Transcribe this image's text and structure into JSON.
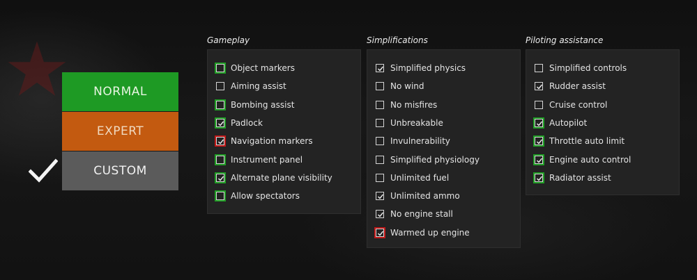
{
  "modes": {
    "normal": "NORMAL",
    "expert": "EXPERT",
    "custom": "CUSTOM",
    "selected": "custom"
  },
  "panels": [
    {
      "title": "Gameplay",
      "options": [
        {
          "label": "Object markers",
          "checked": false,
          "highlight": "green"
        },
        {
          "label": "Aiming assist",
          "checked": false,
          "highlight": "none"
        },
        {
          "label": "Bombing assist",
          "checked": false,
          "highlight": "green"
        },
        {
          "label": "Padlock",
          "checked": true,
          "highlight": "green"
        },
        {
          "label": "Navigation markers",
          "checked": true,
          "highlight": "red"
        },
        {
          "label": "Instrument panel",
          "checked": false,
          "highlight": "green"
        },
        {
          "label": "Alternate plane visibility",
          "checked": true,
          "highlight": "green"
        },
        {
          "label": "Allow spectators",
          "checked": false,
          "highlight": "green"
        }
      ]
    },
    {
      "title": "Simplifications",
      "options": [
        {
          "label": "Simplified physics",
          "checked": true,
          "highlight": "none"
        },
        {
          "label": "No wind",
          "checked": false,
          "highlight": "none"
        },
        {
          "label": "No misfires",
          "checked": false,
          "highlight": "none"
        },
        {
          "label": "Unbreakable",
          "checked": false,
          "highlight": "none"
        },
        {
          "label": "Invulnerability",
          "checked": false,
          "highlight": "none"
        },
        {
          "label": "Simplified physiology",
          "checked": false,
          "highlight": "none"
        },
        {
          "label": "Unlimited fuel",
          "checked": false,
          "highlight": "none"
        },
        {
          "label": "Unlimited ammo",
          "checked": true,
          "highlight": "none"
        },
        {
          "label": "No engine stall",
          "checked": true,
          "highlight": "none"
        },
        {
          "label": "Warmed up engine",
          "checked": true,
          "highlight": "red"
        }
      ]
    },
    {
      "title": "Piloting assistance",
      "options": [
        {
          "label": "Simplified controls",
          "checked": false,
          "highlight": "none"
        },
        {
          "label": "Rudder assist",
          "checked": true,
          "highlight": "none"
        },
        {
          "label": "Cruise control",
          "checked": false,
          "highlight": "none"
        },
        {
          "label": "Autopilot",
          "checked": true,
          "highlight": "green"
        },
        {
          "label": "Throttle auto limit",
          "checked": true,
          "highlight": "green"
        },
        {
          "label": "Engine auto control",
          "checked": true,
          "highlight": "green"
        },
        {
          "label": "Radiator assist",
          "checked": true,
          "highlight": "green"
        }
      ]
    }
  ],
  "colors": {
    "normal": "#1e9a24",
    "expert": "#c35a10",
    "custom": "#5b5b5b",
    "highlight_green": "#1f9d24",
    "highlight_red": "#c01818"
  }
}
